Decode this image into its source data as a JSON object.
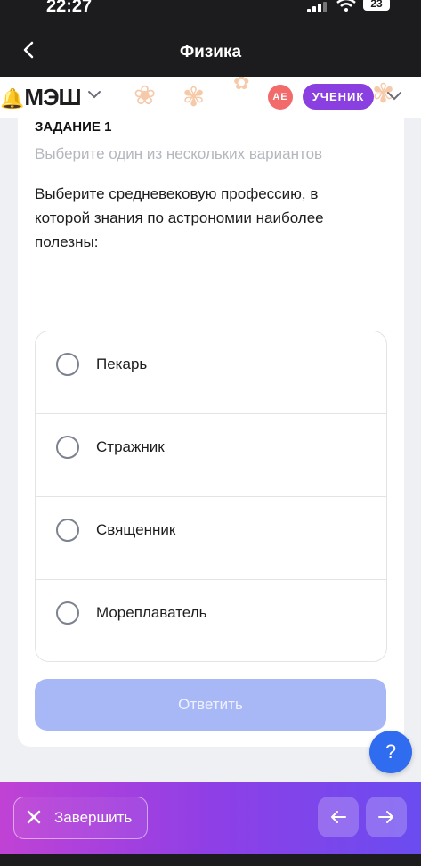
{
  "status": {
    "time": "22:27",
    "battery": "23"
  },
  "nav": {
    "title": "Физика"
  },
  "header": {
    "logo": "МЭШ",
    "avatar_initials": "АЕ",
    "role": "УЧЕНИК"
  },
  "task": {
    "number": "ЗАДАНИЕ 1",
    "instruction": "Выберите один из нескольких вариантов",
    "question": "Выберите средневековую профессию, в которой знания по астрономии наиболее полезны:"
  },
  "options": [
    "Пекарь",
    "Стражник",
    "Священник",
    "Мореплаватель"
  ],
  "submit_label": "Ответить",
  "help_label": "?",
  "bottom": {
    "finish_label": "Завершить"
  },
  "colors": {
    "accent": "#8a3fe0",
    "submit_disabled": "#a8b8f6",
    "help": "#2f6cf0"
  }
}
